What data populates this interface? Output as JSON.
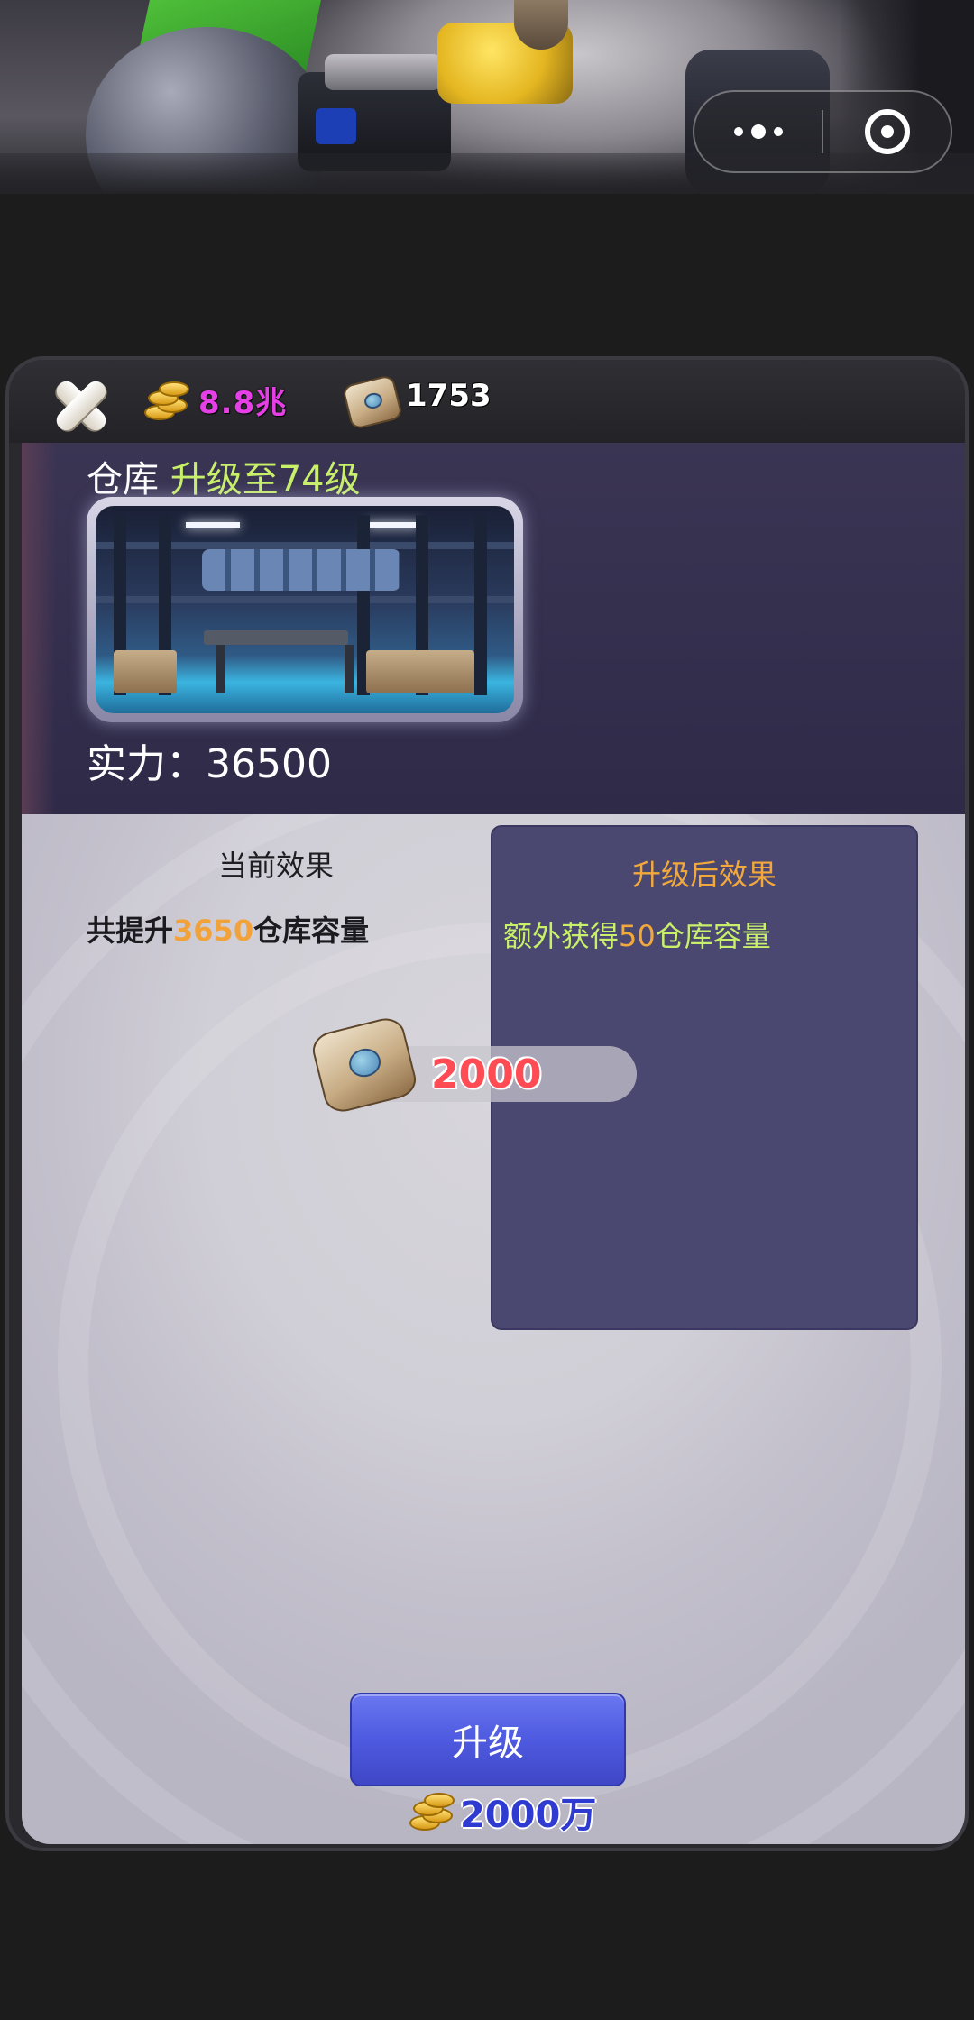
{
  "topbar": {
    "gold_amount": "8.8兆",
    "bag_amount": "1753"
  },
  "header": {
    "building_name": "仓库",
    "upgrade_label": "升级至74级",
    "power_text": "实力：36500"
  },
  "effects": {
    "current_title": "当前效果",
    "current_prefix": "共提升",
    "current_value": "3650",
    "current_suffix": "仓库容量",
    "next_title": "升级后效果",
    "next_prefix": "额外获得",
    "next_value": "50",
    "next_suffix": "仓库容量"
  },
  "cost": {
    "material_amount": "2000",
    "upgrade_button": "升级",
    "gold_price": "2000万"
  },
  "icons": {
    "close": "close-icon",
    "gold": "gold-coins-icon",
    "material": "cement-bag-icon",
    "menu": "more-dots-icon",
    "exit": "target-circle-icon"
  },
  "colors": {
    "gold_amount": "#e53fe6",
    "level_green": "#c8f06a",
    "highlight_orange": "#f2a93b",
    "material_cost_red": "#ff4b53",
    "button_blue": "#4e5ae0",
    "price_blue": "#2f3bd0"
  }
}
